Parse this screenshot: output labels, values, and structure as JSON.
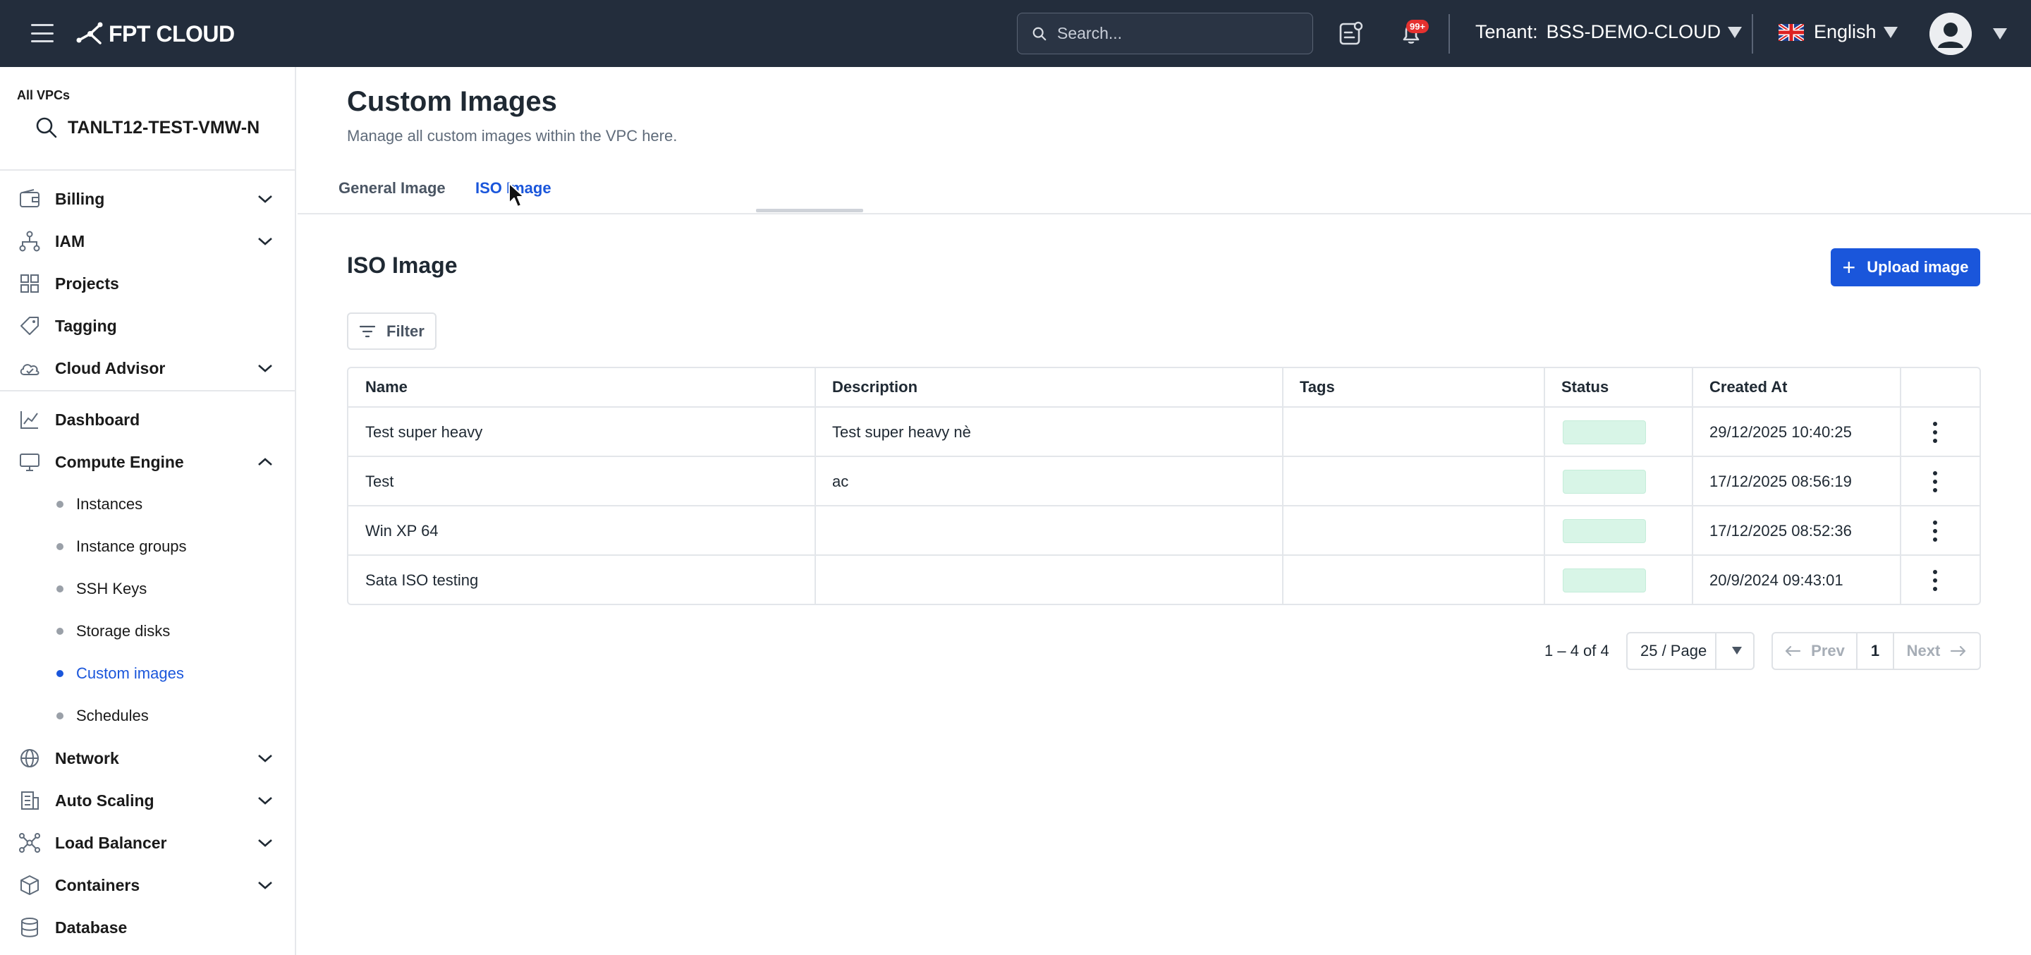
{
  "header": {
    "logo_text": "FPT CLOUD",
    "search_placeholder": "Search...",
    "notification_badge": "99+",
    "tenant_label": "Tenant:",
    "tenant_value": "BSS-DEMO-CLOUD",
    "language": "English"
  },
  "sidebar": {
    "vpc_label": "All VPCs",
    "vpc_name": "TANLT12-TEST-VMW-N",
    "items": [
      {
        "label": "Billing",
        "icon": "wallet-icon"
      },
      {
        "label": "IAM",
        "icon": "org-chart-icon"
      },
      {
        "label": "Projects",
        "icon": "grid-icon"
      },
      {
        "label": "Tagging",
        "icon": "tag-icon"
      },
      {
        "label": "Cloud Advisor",
        "icon": "cloud-check-icon"
      },
      {
        "label": "Dashboard",
        "icon": "chart-icon"
      },
      {
        "label": "Compute Engine",
        "icon": "monitor-icon"
      },
      {
        "label": "Network",
        "icon": "globe-icon"
      },
      {
        "label": "Auto Scaling",
        "icon": "building-icon"
      },
      {
        "label": "Load Balancer",
        "icon": "network-icon"
      },
      {
        "label": "Containers",
        "icon": "cube-icon"
      },
      {
        "label": "Database",
        "icon": "database-icon"
      }
    ],
    "compute_sub": [
      {
        "label": "Instances"
      },
      {
        "label": "Instance groups"
      },
      {
        "label": "SSH Keys"
      },
      {
        "label": "Storage disks"
      },
      {
        "label": "Custom images"
      },
      {
        "label": "Schedules"
      }
    ]
  },
  "main": {
    "title": "Custom Images",
    "subtitle": "Manage all custom images within the VPC here.",
    "tabs": [
      {
        "label": "General Image"
      },
      {
        "label": "ISO Image"
      }
    ],
    "section_title": "ISO Image",
    "upload_label": "Upload image",
    "filter_label": "Filter",
    "columns": [
      "Name",
      "Description",
      "Tags",
      "Status",
      "Created At"
    ],
    "rows": [
      {
        "name": "Test super heavy",
        "description": "Test super heavy nè",
        "tags": "",
        "created_at": "29/12/2025 10:40:25"
      },
      {
        "name": "Test",
        "description": "ac",
        "tags": "",
        "created_at": "17/12/2025 08:56:19"
      },
      {
        "name": "Win XP 64",
        "description": "",
        "tags": "",
        "created_at": "17/12/2025 08:52:36"
      },
      {
        "name": "Sata ISO testing",
        "description": "",
        "tags": "",
        "created_at": "20/9/2024 09:43:01"
      }
    ],
    "pagination": {
      "range": "1 – 4 of 4",
      "page_size": "25 / Page",
      "prev": "Prev",
      "current": "1",
      "next": "Next"
    }
  },
  "colors": {
    "topbar": "#232d3c",
    "accent": "#1a56db",
    "status_pill": "#d8f5e7"
  }
}
